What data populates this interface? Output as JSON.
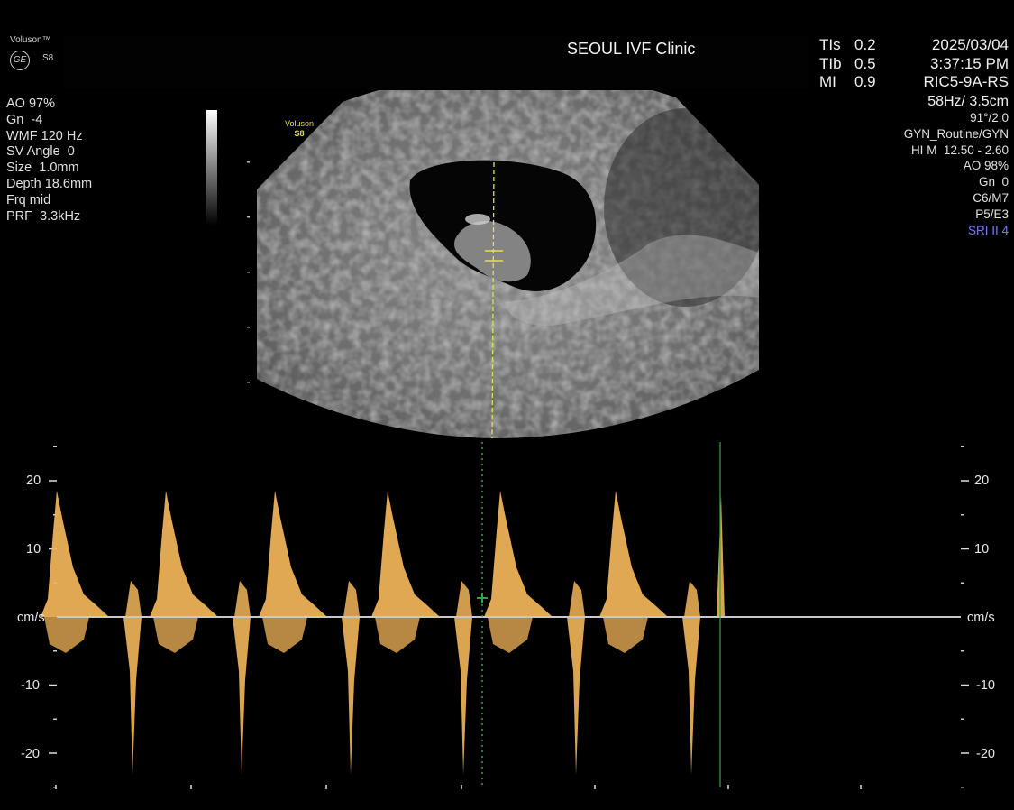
{
  "header": {
    "brand": "Voluson™",
    "logo_text": "GE",
    "model": "S8",
    "clinic": "SEOUL IVF Clinic",
    "indices": [
      {
        "label": "TIs",
        "value": "0.2"
      },
      {
        "label": "TIb",
        "value": "0.5"
      },
      {
        "label": "MI",
        "value": "0.9"
      }
    ],
    "date": "2025/03/04",
    "time": "3:37:15 PM",
    "probe": "RIC5-9A-RS"
  },
  "left_params": [
    "AO 97%",
    "Gn  -4",
    "WMF 120 Hz",
    "SV Angle  0",
    "Size  1.0mm",
    "Depth 18.6mm",
    "Frq mid",
    "PRF  3.3kHz"
  ],
  "right_params": {
    "freq": "58Hz/ 3.5cm",
    "lines": [
      "91°/2.0",
      "GYN_Routine/GYN",
      "HI M  12.50 - 2.60",
      "AO 98%",
      "Gn  0",
      "C6/M7",
      "P5/E3"
    ],
    "sri": "SRI II 4",
    "sri_color": "#7a7aff"
  },
  "image_label": {
    "brand": "Voluson",
    "model": "S8",
    "color": "#e8e24a"
  },
  "doppler": {
    "unit": "cm/s",
    "scale_ticks": [
      "20",
      "10",
      "-10",
      "-20"
    ],
    "scale_values": [
      20,
      10,
      -10,
      -20
    ],
    "spectrum_color": "#f3b65a",
    "baseline_color": "#c8c8c8",
    "sweep_marker_color": "#2fa83a"
  }
}
